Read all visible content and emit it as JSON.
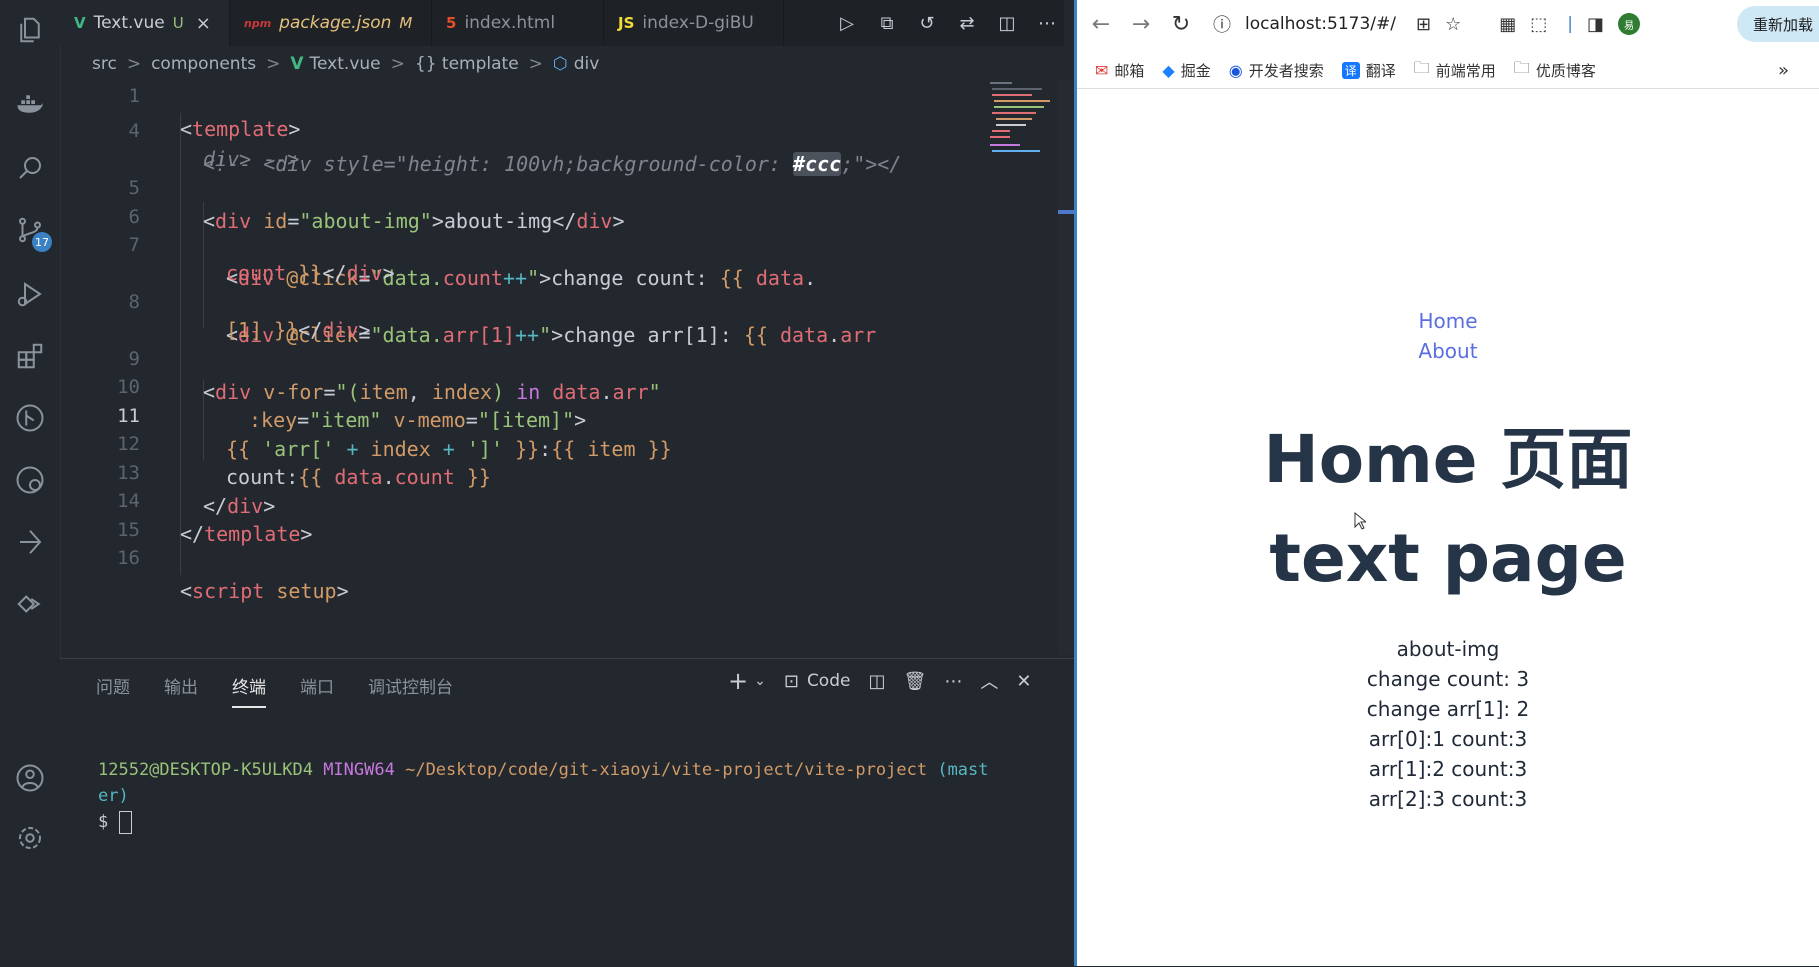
{
  "activity_bar": {
    "scm_badge": "17",
    "icons": [
      "files-icon",
      "docker-icon",
      "search-icon",
      "source-control-icon",
      "run-debug-icon",
      "extensions-icon",
      "git-graph-icon",
      "remote-explorer-icon",
      "testing-icon",
      "live-share-icon",
      "account-icon",
      "settings-gear-icon"
    ]
  },
  "tabs": [
    {
      "icon": "V",
      "label": "Text.vue",
      "flag": "U"
    },
    {
      "icon": "npm",
      "label": "package.json",
      "flag": "M"
    },
    {
      "icon": "5",
      "label": "index.html",
      "flag": ""
    },
    {
      "icon": "JS",
      "label": "index-D-giBU",
      "flag": ""
    }
  ],
  "breadcrumb": {
    "p1": "src",
    "p2": "components",
    "p3": "Text.vue",
    "p4": "{} template",
    "p5": "div"
  },
  "editor": {
    "line_numbers": [
      "1",
      "4",
      "",
      "5",
      "6",
      "7",
      "",
      "8",
      "",
      "9",
      "10",
      "11",
      "12",
      "13",
      "14",
      "15",
      "16"
    ],
    "l1_tag": "template",
    "l4_comment": "<!-- <div style=\"height: 100vh;background-color: ",
    "l4_ccc": "#ccc",
    "l4_end": ";\"></",
    "l4b": "div> -->",
    "l5_tag": "div",
    "l5_attr": "id",
    "l5_val": "\"about-img\"",
    "l5_text": "about-img",
    "l7_attr": "@click",
    "l7_val1": "\"data.",
    "l7_val2": "count",
    "l7_op": "++",
    "l7_q": "\"",
    "l7_text": "change count: ",
    "l7_mo": "{{",
    "l7_var": "data",
    "l7b_var": "count",
    "l7b_mc": "}}",
    "l8_attr": "@click",
    "l8_val1": "\"data.",
    "l8_val2": "arr[1]",
    "l8_op": "++",
    "l8_q": "\"",
    "l8_text": "change arr[1]: ",
    "l8_mo": "{{",
    "l8_var": "data",
    "l8_prop": "arr",
    "l8b": "[1]",
    "l8b_mc": "}}",
    "l9_tag": "div",
    "l9_attr": "v-for",
    "l9_q": "\"(",
    "l9_item": "item",
    "l9_comma": ", ",
    "l9_index": "index",
    "l9_close": ") ",
    "l9_in": "in ",
    "l9_data": "data",
    "l9_arr": "arr",
    "l9_q2": "\"",
    "l10_attr1": ":key",
    "l10_val1": "\"item\"",
    "l10_attr2": "v-memo",
    "l10_val2": "\"[item]\"",
    "l11_mo": "{{",
    "l11_s1": "'arr['",
    "l11_plus": "+",
    "l11_index": "index",
    "l11_s2": "']'",
    "l11_mc": "}}",
    "l11_colon": ":",
    "l11_mo2": "{{",
    "l11_item": "item",
    "l11_mc2": "}}",
    "l12_text": "count:",
    "l12_mo": "{{",
    "l12_data": "data",
    "l12_count": "count",
    "l12_mc": "}}",
    "l13_tag": "div",
    "l14_tag": "template",
    "l16_tag": "script",
    "l16_attr": "setup"
  },
  "panel": {
    "tabs": [
      "问题",
      "输出",
      "终端",
      "端口",
      "调试控制台"
    ],
    "active_tab": "终端",
    "terminal_label": "Code",
    "prompt_user": "12552@DESKTOP-K5ULKD4",
    "prompt_shell": "MINGW64",
    "prompt_path": "~/Desktop/code/git-xiaoyi/vite-project/vite-project",
    "prompt_branch": "(mast",
    "prompt_branch2": "er)",
    "prompt_symbol": "$"
  },
  "browser": {
    "url": "localhost:5173/#/",
    "reload_button": "重新加载",
    "bookmarks": [
      "邮箱",
      "掘金",
      "开发者搜索",
      "翻译",
      "前端常用",
      "优质博客"
    ],
    "avatar": "易"
  },
  "page": {
    "nav_home": "Home",
    "nav_about": "About",
    "home_title": "Home 页面",
    "text_title": "text page",
    "lines": [
      "about-img",
      "change count: 3",
      "change arr[1]: 2",
      "arr[0]:1 count:3",
      "arr[1]:2 count:3",
      "arr[2]:3 count:3"
    ]
  },
  "colors": {
    "accent": "#3b82c4",
    "vue_green": "#41b883",
    "link": "#5b6ee1",
    "heading": "#253447"
  }
}
